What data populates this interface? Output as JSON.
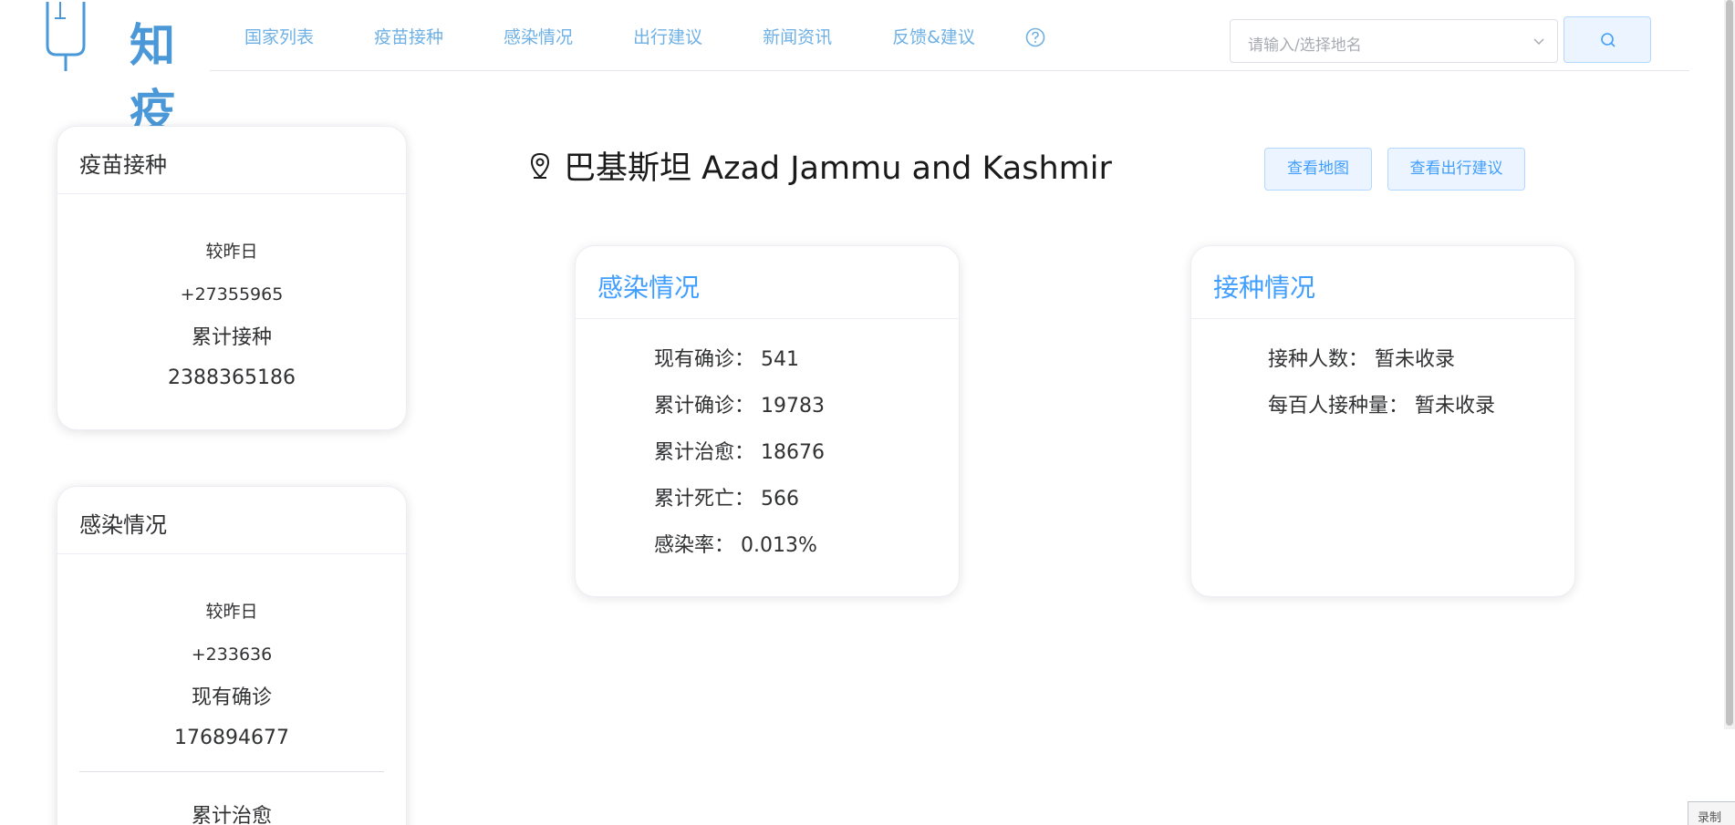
{
  "brand": {
    "logo_text": "知疫",
    "accent_color": "#409eff"
  },
  "nav": {
    "items": [
      "国家列表",
      "疫苗接种",
      "感染情况",
      "出行建议",
      "新闻资讯",
      "反馈&建议"
    ],
    "help_icon": "question-circle-icon"
  },
  "search": {
    "placeholder": "请输入/选择地名",
    "button_icon": "search-icon"
  },
  "sidebar": {
    "vaccine_card": {
      "title": "疫苗接种",
      "compare_label": "较昨日",
      "compare_value": "+27355965",
      "total_label": "累计接种",
      "total_value": "2388365186"
    },
    "infection_card": {
      "title": "感染情况",
      "compare_label": "较昨日",
      "compare_value": "+233636",
      "current_label": "现有确诊",
      "current_value": "176894677",
      "next_label": "累计治愈"
    }
  },
  "place": {
    "name": "巴基斯坦 Azad Jammu and Kashmir",
    "icon": "location-pin-icon"
  },
  "actions": {
    "view_map": "查看地图",
    "view_travel": "查看出行建议"
  },
  "infection": {
    "title": "感染情况",
    "rows": [
      {
        "label": "现有确诊：",
        "value": "541"
      },
      {
        "label": "累计确诊：",
        "value": "19783"
      },
      {
        "label": "累计治愈：",
        "value": "18676"
      },
      {
        "label": "累计死亡：",
        "value": "566"
      },
      {
        "label": "感染率：",
        "value": "0.013%"
      }
    ]
  },
  "vaccination": {
    "title": "接种情况",
    "rows": [
      {
        "label": "接种人数：",
        "value": "暂未收录"
      },
      {
        "label": "每百人接种量：",
        "value": "暂未收录"
      }
    ]
  },
  "recorder_tab": "录制"
}
